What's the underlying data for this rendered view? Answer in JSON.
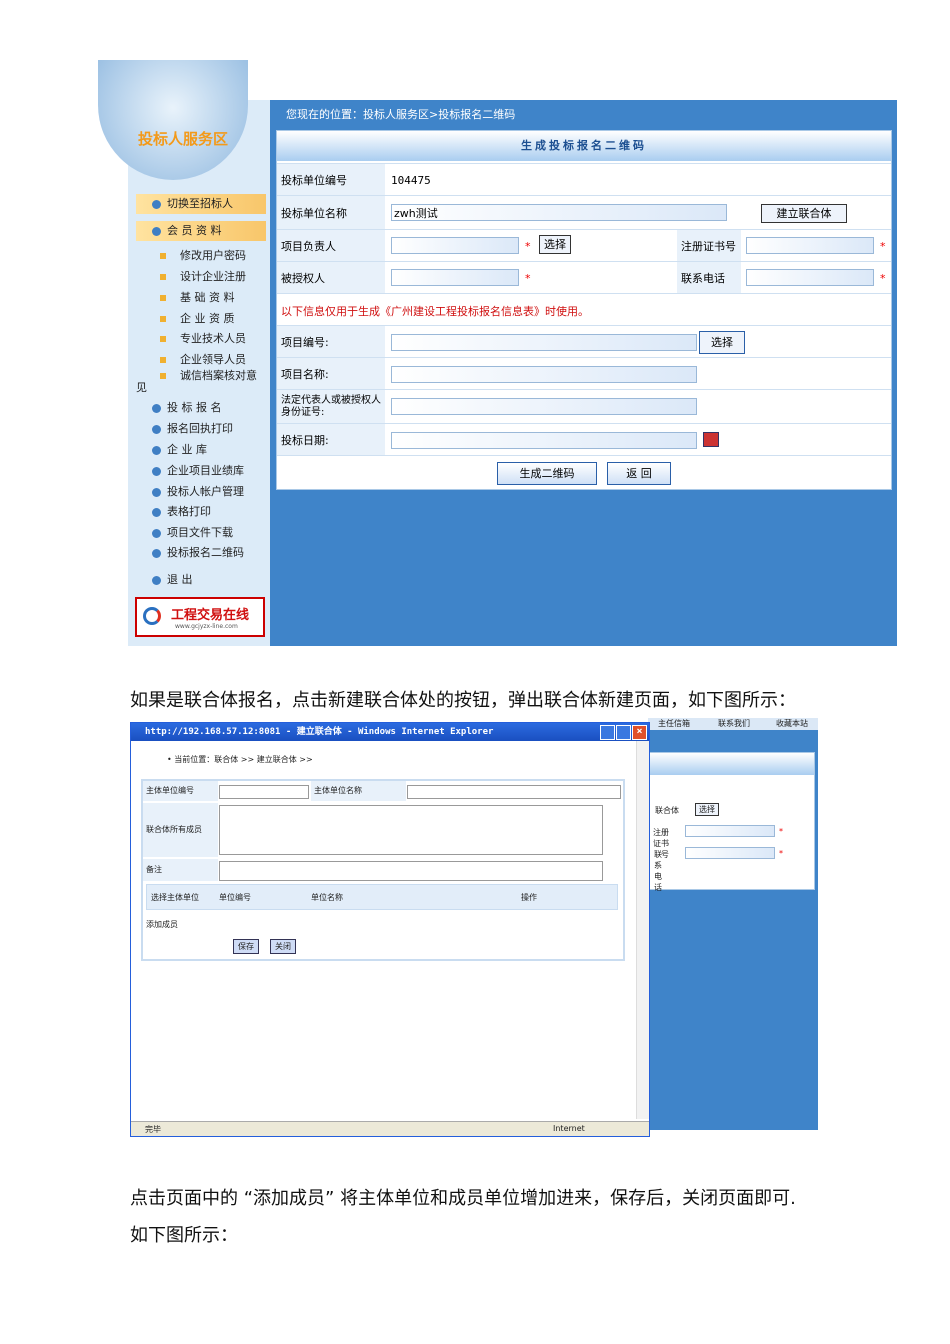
{
  "screenshot1": {
    "sidebar": {
      "title": "投标人服务区",
      "items": [
        {
          "label": "切换至招标人",
          "type": "main",
          "highlight": true
        },
        {
          "label": "会 员 资 料",
          "type": "main",
          "highlight": true
        },
        {
          "label": "修改用户密码",
          "type": "sub"
        },
        {
          "label": "设计企业注册",
          "type": "sub"
        },
        {
          "label": "基 础 资 料",
          "type": "sub"
        },
        {
          "label": "企 业 资 质",
          "type": "sub"
        },
        {
          "label": "专业技术人员",
          "type": "sub"
        },
        {
          "label": "企业领导人员",
          "type": "sub"
        },
        {
          "label": "诚信档案核对意见",
          "type": "sub"
        },
        {
          "label": "投 标 报 名",
          "type": "main"
        },
        {
          "label": "报名回执打印",
          "type": "main"
        },
        {
          "label": "企 业 库",
          "type": "main"
        },
        {
          "label": "企业项目业绩库",
          "type": "main"
        },
        {
          "label": "投标人帐户管理",
          "type": "main"
        },
        {
          "label": "表格打印",
          "type": "main"
        },
        {
          "label": "项目文件下载",
          "type": "main"
        },
        {
          "label": "投标报名二维码",
          "type": "main"
        },
        {
          "label": "退  出",
          "type": "main"
        }
      ],
      "logo_text": "工程交易在线",
      "logo_url_text": "www.gcjyzx-line.com"
    },
    "breadcrumb": "您现在的位置：投标人服务区>投标报名二维码",
    "panel_title": "生成投标报名二维码",
    "form": {
      "unit_no_label": "投标单位编号",
      "unit_no_value": "104475",
      "unit_name_label": "投标单位名称",
      "unit_name_value": "zwh测试",
      "consortium_button": "建立联合体",
      "manager_label": "项目负责人",
      "select_button": "选择",
      "cert_label": "注册证书号",
      "authorized_label": "被授权人",
      "phone_label": "联系电话",
      "notice": "以下信息仅用于生成《广州建设工程投标报名信息表》时使用。",
      "project_no_label": "项目编号:",
      "project_select_button": "选择",
      "project_name_label": "项目名称:",
      "id_label": "法定代表人或被授权人身份证号:",
      "date_label": "投标日期:",
      "generate_button": "生成二维码",
      "back_button": "返  回",
      "required_mark": "*"
    }
  },
  "paragraph1": "如果是联合体报名，点击新建联合体处的按钮，弹出联合体新建页面，如下图所示：",
  "screenshot2": {
    "window_title": "http://192.168.57.12:8081 - 建立联合体 - Windows Internet Explorer",
    "breadcrumb": "当前位置：联合体 >> 建立联合体 >>",
    "main_no_label": "主体单位编号",
    "main_name_label": "主体单位名称",
    "members_label": "联合体所有成员",
    "remark_label": "备注",
    "columns": [
      "选择主体单位",
      "单位编号",
      "单位名称",
      "操作"
    ],
    "add_member": "添加成员",
    "save_button": "保存",
    "close_button": "关闭",
    "status_left": "完毕",
    "status_right": "Internet",
    "bg_links": [
      "主任信箱",
      "联系我们",
      "收藏本站"
    ],
    "bg_labels": [
      "联合体",
      "注册证书号",
      "联系电话"
    ],
    "bg_select": "选择"
  },
  "paragraph2": "点击页面中的 “添加成员” 将主体单位和成员单位增加进来，保存后，关闭页面即可.",
  "paragraph3": "如下图所示："
}
